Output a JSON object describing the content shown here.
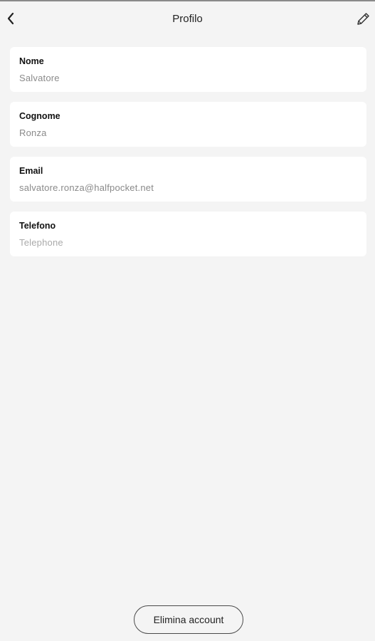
{
  "header": {
    "title": "Profilo",
    "back_icon": "chevron-left-icon",
    "edit_icon": "pencil-icon"
  },
  "fields": [
    {
      "label": "Nome",
      "value": "Salvatore"
    },
    {
      "label": "Cognome",
      "value": "Ronza"
    },
    {
      "label": "Email",
      "value": "salvatore.ronza@halfpocket.net"
    },
    {
      "label": "Telefono",
      "placeholder": "Telephone"
    }
  ],
  "actions": {
    "delete_account_label": "Elimina account"
  }
}
